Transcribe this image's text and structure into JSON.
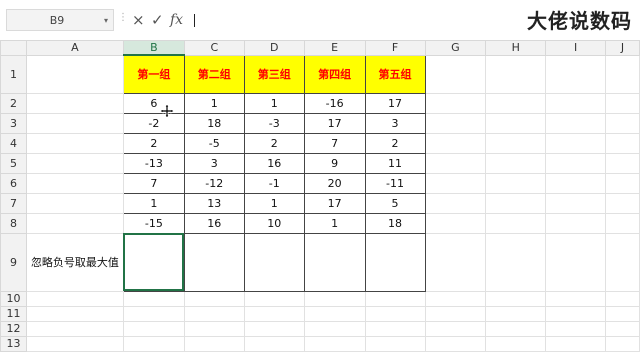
{
  "formula_bar": {
    "name_box": "B9",
    "name_box_arrow": "▾",
    "separator": "⋮",
    "cancel_icon": "×",
    "enter_icon": "✓",
    "fx_label": "fx",
    "formula": ""
  },
  "watermark": "大佬说数码",
  "columns": [
    "A",
    "B",
    "C",
    "D",
    "E",
    "F",
    "G",
    "H",
    "I",
    "J"
  ],
  "rows": [
    "1",
    "2",
    "3",
    "4",
    "5",
    "6",
    "7",
    "8",
    "9",
    "10",
    "11",
    "12",
    "13"
  ],
  "headers": [
    "第一组",
    "第二组",
    "第三组",
    "第四组",
    "第五组"
  ],
  "table_rows": [
    [
      "6",
      "1",
      "1",
      "-16",
      "17"
    ],
    [
      "-2",
      "18",
      "-3",
      "17",
      "3"
    ],
    [
      "2",
      "-5",
      "2",
      "7",
      "2"
    ],
    [
      "-13",
      "3",
      "16",
      "9",
      "11"
    ],
    [
      "7",
      "-12",
      "-1",
      "20",
      "-11"
    ],
    [
      "1",
      "13",
      "1",
      "17",
      "5"
    ],
    [
      "-15",
      "16",
      "10",
      "1",
      "18"
    ]
  ],
  "row9_label": "忽略负号取最大值",
  "colors": {
    "header_fill": "#ffff00",
    "header_text": "#ff0000",
    "selection": "#217346"
  }
}
